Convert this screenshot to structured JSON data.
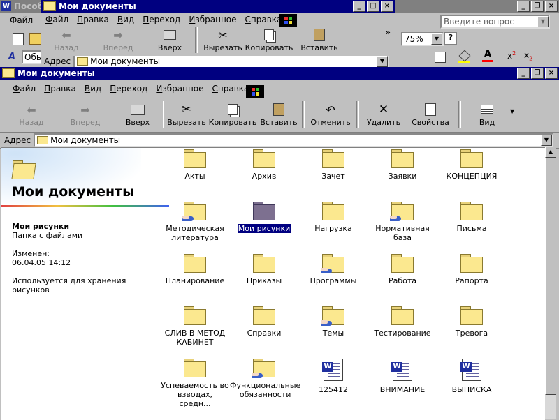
{
  "word_window": {
    "title": "Пособ",
    "menu_first": "Файл",
    "style_value": "Обы",
    "help_placeholder": "Введите вопрос",
    "zoom": "75%",
    "help_icon": "?"
  },
  "back_window": {
    "title": "Мои документы",
    "menu": [
      "Файл",
      "Правка",
      "Вид",
      "Переход",
      "Избранное",
      "Справка"
    ],
    "tools": [
      {
        "label": "Назад",
        "icon": "back-arrow-icon",
        "disabled": true
      },
      {
        "label": "Вперед",
        "icon": "forward-arrow-icon",
        "disabled": true
      },
      {
        "label": "Вверх",
        "icon": "up-folder-icon",
        "disabled": false
      },
      {
        "label": "Вырезать",
        "icon": "scissors-icon",
        "disabled": false
      },
      {
        "label": "Копировать",
        "icon": "copy-icon",
        "disabled": false
      },
      {
        "label": "Вставить",
        "icon": "paste-icon",
        "disabled": false
      }
    ],
    "address_label": "Адрес",
    "address_value": "Мои документы"
  },
  "main_window": {
    "title": "Мои документы",
    "menu": [
      "Файл",
      "Правка",
      "Вид",
      "Переход",
      "Избранное",
      "Справка"
    ],
    "tools": [
      {
        "label": "Назад",
        "icon": "back-arrow-icon",
        "disabled": true
      },
      {
        "label": "Вперед",
        "icon": "forward-arrow-icon",
        "disabled": true
      },
      {
        "label": "Вверх",
        "icon": "up-folder-icon",
        "disabled": false
      },
      {
        "label": "Вырезать",
        "icon": "scissors-icon",
        "disabled": false
      },
      {
        "label": "Копировать",
        "icon": "copy-icon",
        "disabled": false
      },
      {
        "label": "Вставить",
        "icon": "paste-icon",
        "disabled": false
      },
      {
        "label": "Отменить",
        "icon": "undo-icon",
        "disabled": false
      },
      {
        "label": "Удалить",
        "icon": "delete-icon",
        "disabled": false
      },
      {
        "label": "Свойства",
        "icon": "properties-icon",
        "disabled": false
      },
      {
        "label": "Вид",
        "icon": "view-icon",
        "disabled": false
      }
    ],
    "address_label": "Адрес",
    "address_value": "Мои документы"
  },
  "info_panel": {
    "heading": "Мои документы",
    "selected_name": "Мои рисунки",
    "selected_type": "Папка с файлами",
    "modified_label": "Изменен:",
    "modified_value": "06.04.05 14:12",
    "description": "Используется для хранения рисунков"
  },
  "files": [
    {
      "name": "Акты",
      "type": "folder"
    },
    {
      "name": "Архив",
      "type": "folder"
    },
    {
      "name": "Зачет",
      "type": "folder"
    },
    {
      "name": "Заявки",
      "type": "folder"
    },
    {
      "name": "КОНЦЕПЦИЯ",
      "type": "folder"
    },
    {
      "name": "Методическая литература",
      "type": "shared-folder"
    },
    {
      "name": "Мои рисунки",
      "type": "folder",
      "selected": true
    },
    {
      "name": "Нагрузка",
      "type": "folder"
    },
    {
      "name": "Нормативная база",
      "type": "shared-folder"
    },
    {
      "name": "Письма",
      "type": "folder"
    },
    {
      "name": "Планирование",
      "type": "folder"
    },
    {
      "name": "Приказы",
      "type": "folder"
    },
    {
      "name": "Программы",
      "type": "shared-folder"
    },
    {
      "name": "Работа",
      "type": "folder"
    },
    {
      "name": "Рапорта",
      "type": "folder"
    },
    {
      "name": "СЛИВ В МЕТОД КАБИНЕТ",
      "type": "folder"
    },
    {
      "name": "Справки",
      "type": "folder"
    },
    {
      "name": "Темы",
      "type": "shared-folder"
    },
    {
      "name": "Тестирование",
      "type": "folder"
    },
    {
      "name": "Тревога",
      "type": "folder"
    },
    {
      "name": "Успеваемость во взводах, средн...",
      "type": "folder"
    },
    {
      "name": "Функциональные обязанности",
      "type": "shared-folder"
    },
    {
      "name": "125412",
      "type": "word-doc"
    },
    {
      "name": "ВНИМАНИЕ",
      "type": "word-doc"
    },
    {
      "name": "ВЫПИСКА",
      "type": "word-doc"
    }
  ],
  "colors": {
    "titlebar": "#000080",
    "window": "#c0c0c0",
    "folder": "#fbe88f",
    "selection": "#000080"
  }
}
